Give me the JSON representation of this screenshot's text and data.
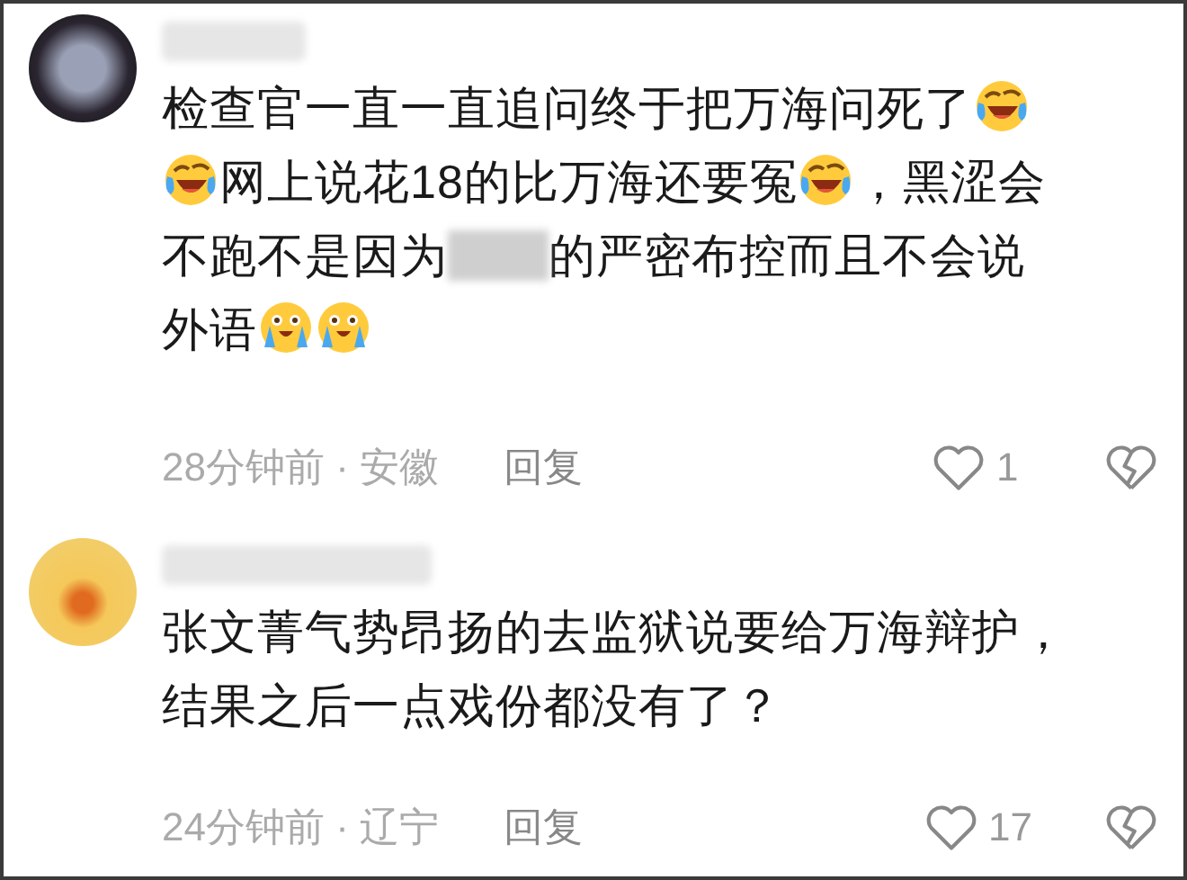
{
  "comments": [
    {
      "lines": [
        [
          {
            "kind": "text",
            "text": "检查官一直一直追问终于把万海问死了"
          },
          {
            "kind": "laugh-cry"
          }
        ],
        [
          {
            "kind": "laugh-cry"
          },
          {
            "kind": "text",
            "text": "网上说花18的比万海还要冤"
          },
          {
            "kind": "laugh-cry"
          },
          {
            "kind": "text",
            "text": "，黑涩会"
          }
        ],
        [
          {
            "kind": "text",
            "text": "不跑不是因为"
          },
          {
            "kind": "blur"
          },
          {
            "kind": "text",
            "text": "的严密布控而且不会说"
          }
        ],
        [
          {
            "kind": "text",
            "text": "外语"
          },
          {
            "kind": "tears"
          },
          {
            "kind": "tears"
          }
        ]
      ],
      "meta": "28分钟前 · 安徽",
      "reply": "回复",
      "likes": "1"
    },
    {
      "lines": [
        [
          {
            "kind": "text",
            "text": "张文菁气势昂扬的去监狱说要给万海辩护，"
          }
        ],
        [
          {
            "kind": "text",
            "text": "结果之后一点戏份都没有了？"
          }
        ]
      ],
      "meta": "24分钟前 · 辽宁",
      "reply": "回复",
      "likes": "17"
    }
  ]
}
